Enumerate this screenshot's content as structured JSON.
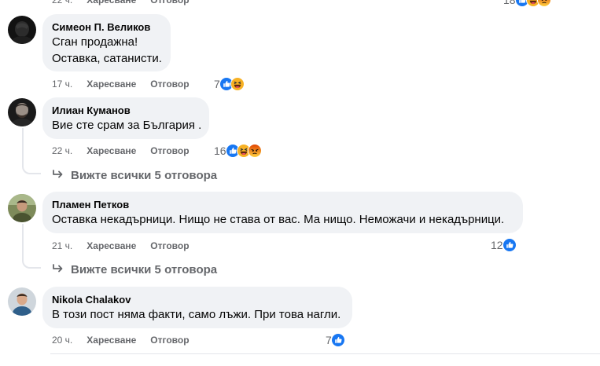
{
  "top_partial": {
    "time": "22 ч.",
    "like_label": "Харесване",
    "reply_label": "Отговор",
    "reaction_count": "18"
  },
  "comments": [
    {
      "author": "Симеон П. Великов",
      "lines": [
        "Сган продажна!",
        "Оставка, сатанисти."
      ],
      "time": "17 ч.",
      "like_label": "Харесване",
      "reply_label": "Отговор",
      "reaction_count": "7",
      "reactions": [
        "like-icon",
        "haha-icon"
      ]
    },
    {
      "author": "Илиан Куманов",
      "lines": [
        "Вие сте срам за България ."
      ],
      "time": "22 ч.",
      "like_label": "Харесване",
      "reply_label": "Отговор",
      "reaction_count": "16",
      "reactions": [
        "like-icon",
        "haha-icon",
        "angry-icon"
      ],
      "replies_label": "Вижте всички 5 отговора"
    },
    {
      "author": "Пламен Петков",
      "lines": [
        "Оставка некадърници. Нищо не става от вас. Ма нищо. Неможачи и некадърници."
      ],
      "time": "21 ч.",
      "like_label": "Харесване",
      "reply_label": "Отговор",
      "reaction_count": "12",
      "reactions": [
        "like-icon"
      ],
      "replies_label": "Вижте всички 5 отговора"
    },
    {
      "author": "Nikola Chalakov",
      "lines": [
        "В този пост няма факти, само лъжи. При това нагли."
      ],
      "time": "20 ч.",
      "like_label": "Харесване",
      "reply_label": "Отговор",
      "reaction_count": "7",
      "reactions": [
        "like-icon"
      ]
    }
  ],
  "colors": {
    "bubble": "#f0f2f5",
    "secondary_text": "#65676b",
    "like_blue": "#1877f2",
    "haha_yellow": "#f7b125",
    "angry_red": "#e9710f"
  }
}
